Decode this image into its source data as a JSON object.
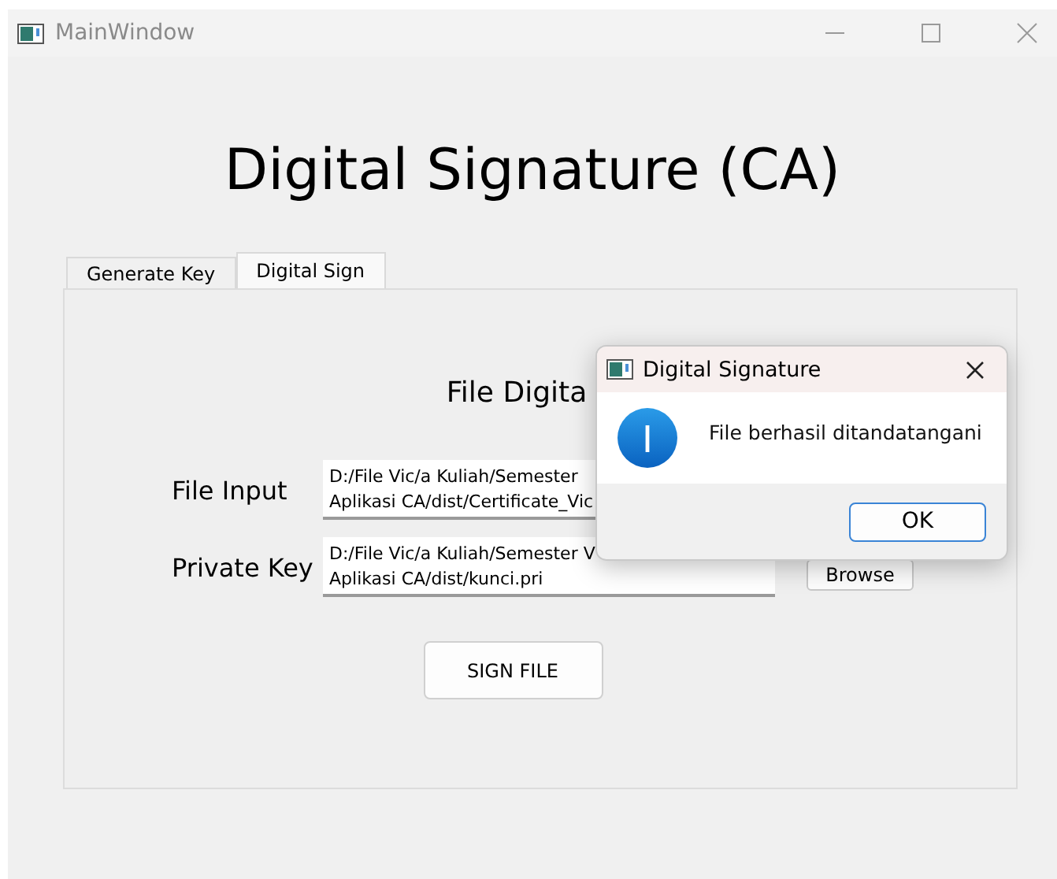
{
  "window": {
    "title": "MainWindow"
  },
  "heading": "Digital Signature (CA)",
  "tabs": [
    {
      "label": "Generate Key",
      "selected": false
    },
    {
      "label": "Digital Sign",
      "selected": true
    }
  ],
  "panel": {
    "title": "File Digita",
    "fields": [
      {
        "label": "File Input",
        "lines": [
          "D:/File Vic/a Kuliah/Semester",
          "Aplikasi CA/dist/Certificate_Vic"
        ]
      },
      {
        "label": "Private Key",
        "lines": [
          "D:/File Vic/a Kuliah/Semester V",
          "Aplikasi CA/dist/kunci.pri"
        ]
      }
    ],
    "browse_button": "Browse",
    "sign_button": "SIGN FILE"
  },
  "dialog": {
    "title": "Digital Signature",
    "message": "File berhasil ditandatangani",
    "button": "OK"
  }
}
